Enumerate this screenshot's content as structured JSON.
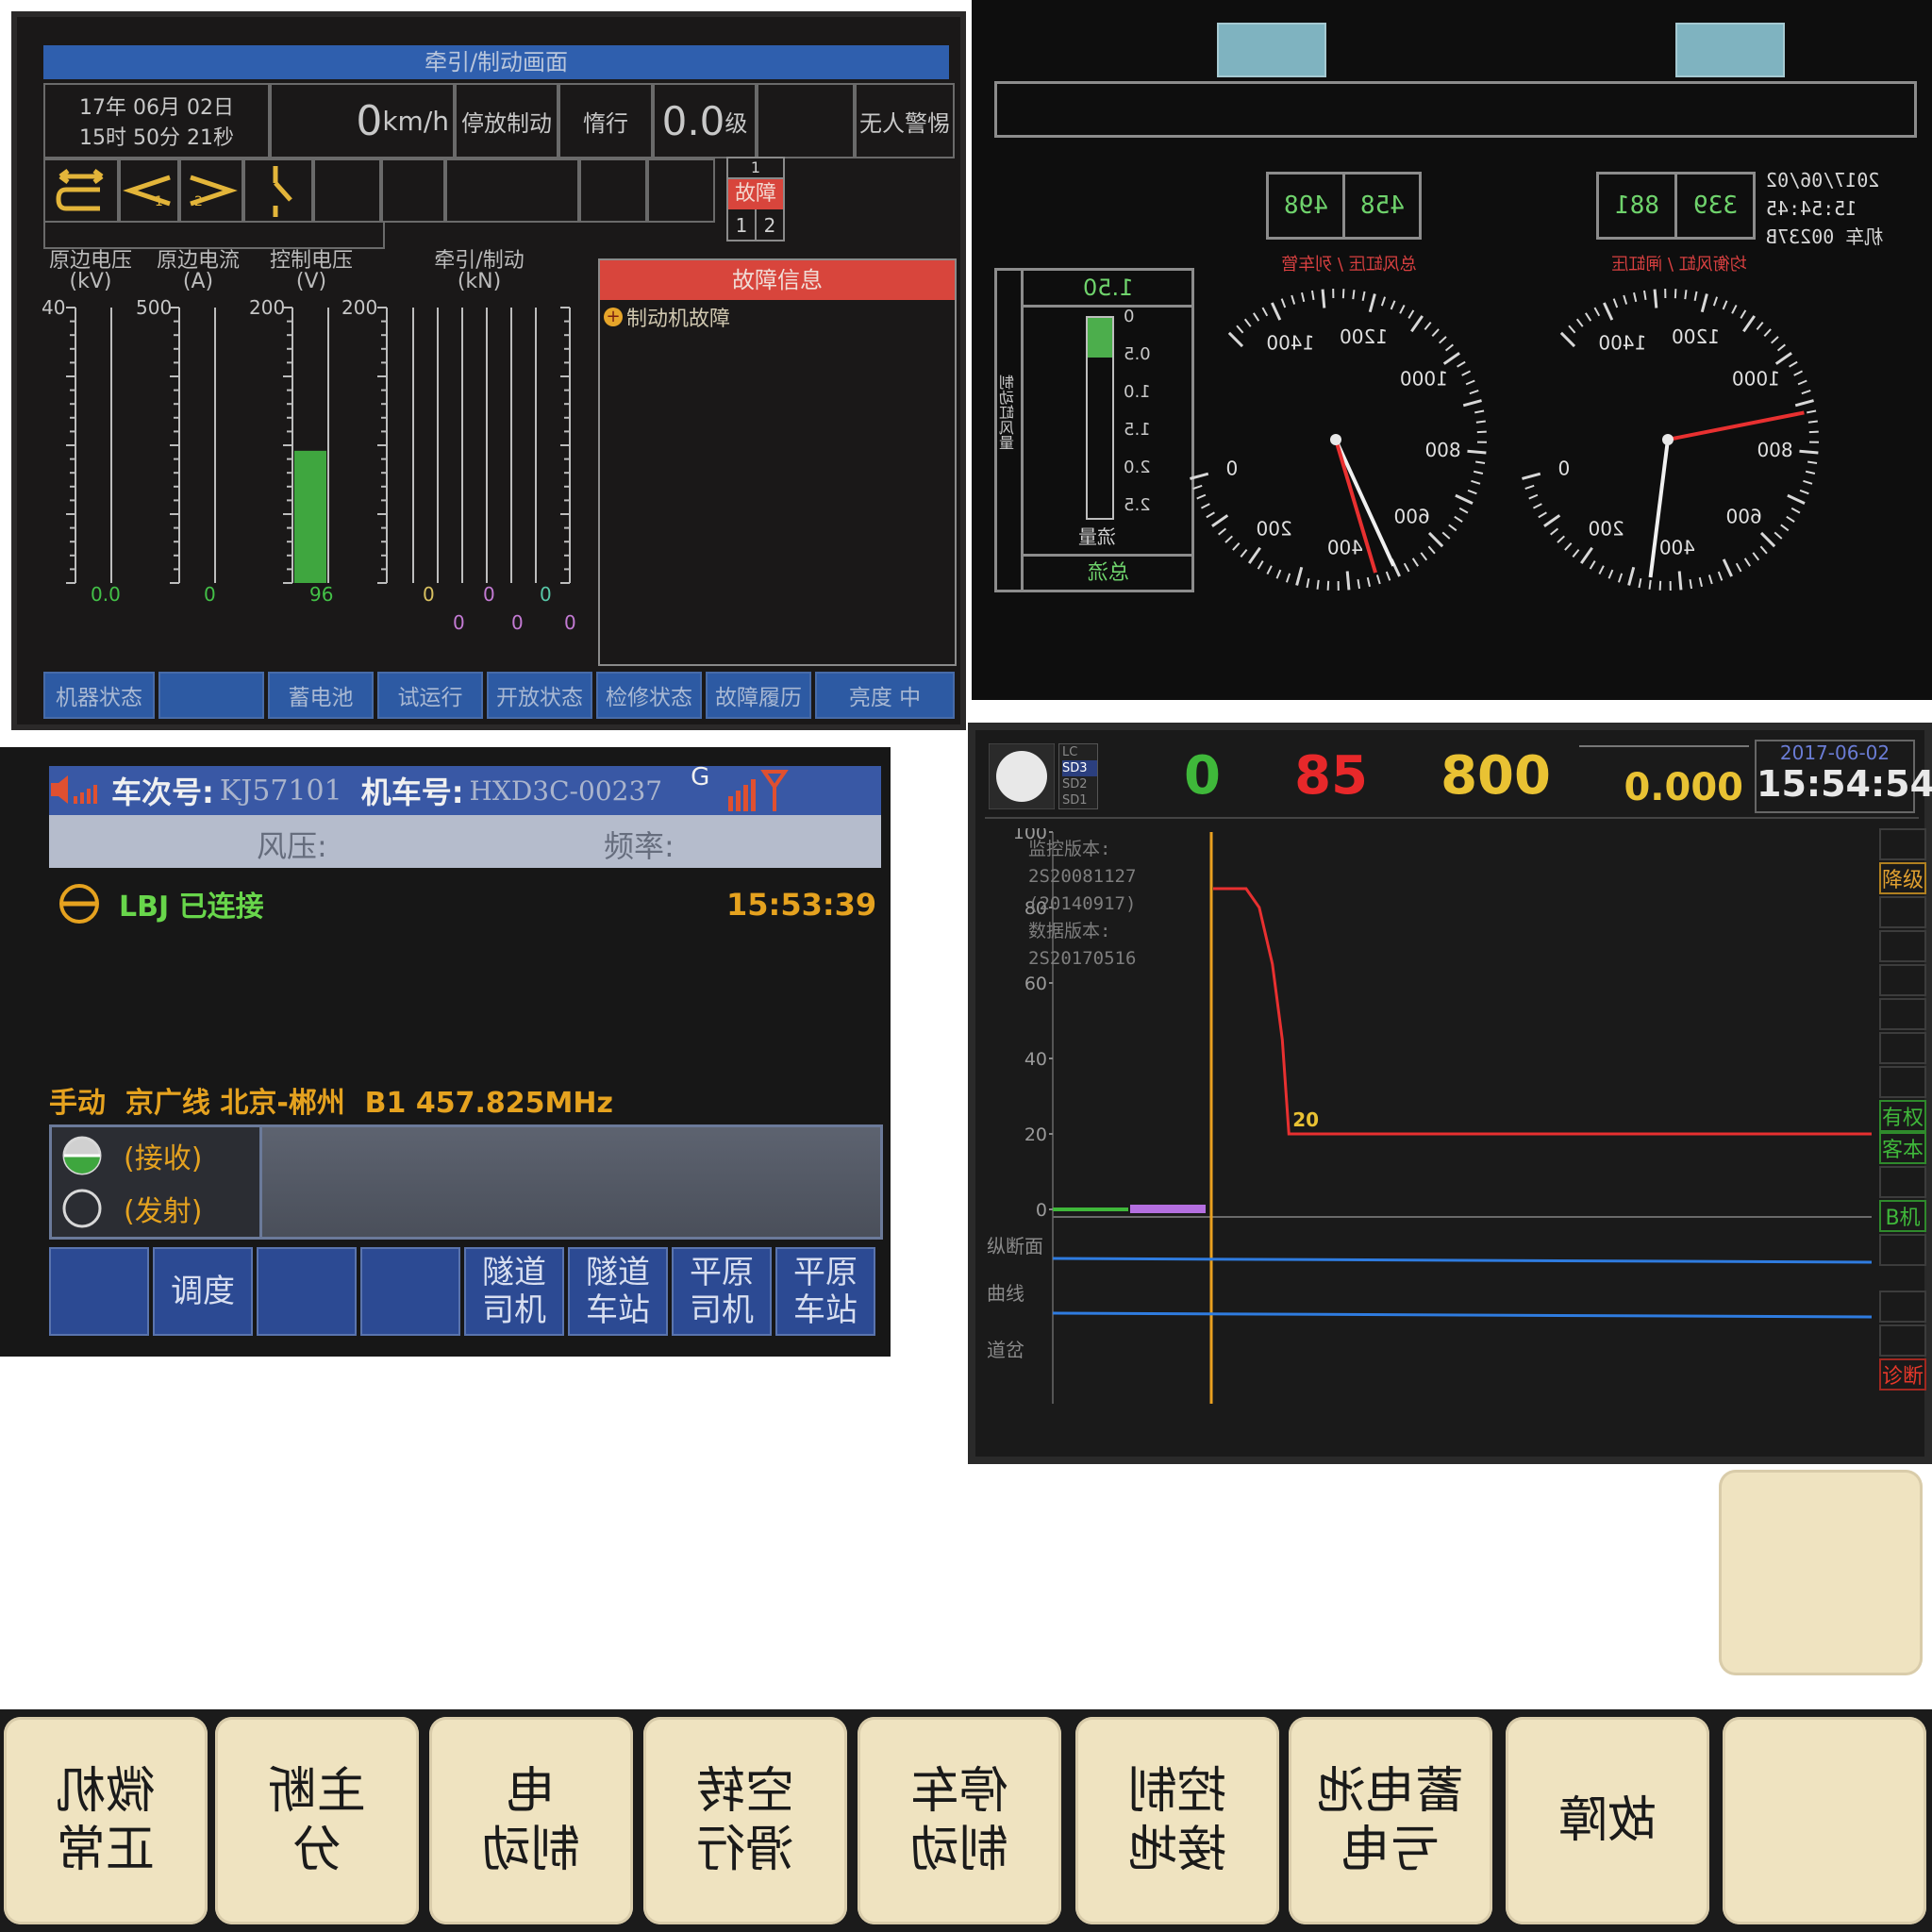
{
  "panel_traction": {
    "title": "牵引/制动画面",
    "date_line1": "17年  06月  02日",
    "date_line2": "15时  50分  21秒",
    "speed_value": "0",
    "speed_unit": "km/h",
    "status_parking": "停放制动",
    "status_coast": "惰行",
    "level_value": "0.0",
    "level_unit": "级",
    "vigilance": "无人警惕",
    "fault_indicator": "故障",
    "fault_idx_1": "1",
    "fault_idx_2": "1",
    "fault_idx_3": "2",
    "meter_labels": [
      "原边电压\n(kV)",
      "原边电流\n(A)",
      "控制电压\n(V)",
      "牵引/制动\n(kN)"
    ],
    "meter_max": [
      "40",
      "500",
      "200",
      "200"
    ],
    "meter_values": [
      "0.0",
      "0",
      "96"
    ],
    "control_voltage_fill_fraction": 0.48,
    "traction_values_top": [
      "0",
      "0",
      "0"
    ],
    "traction_values_bottom": [
      "0",
      "0",
      "0"
    ],
    "fault_info_title": "故障信息",
    "fault_item": "制动机故障",
    "soft_buttons": [
      "机器状态",
      "",
      "蓄电池",
      "试运行",
      "开放状态",
      "检修状态",
      "故障履历",
      "亮度   中"
    ]
  },
  "panel_gauges": {
    "left_box_values": [
      "498",
      "458"
    ],
    "right_box_values": [
      "881",
      "339"
    ],
    "datetime_lines": [
      "2017/06/02",
      "15:54:45",
      "机车  00237B"
    ],
    "left_caption": "总风缸压 / 列车管",
    "right_caption": "均衡风缸 / 闸缸压",
    "bar_top_value": "1.50",
    "bar_scale": [
      "0",
      "0.5",
      "1.0",
      "1.5",
      "2.0",
      "2.5"
    ],
    "bar_fill_fraction": 0.5,
    "bar_bottom_label": "流量",
    "bar_foot_label": "总流",
    "bar_side_label": "制动缸风量",
    "dial_labels": [
      "0",
      "200",
      "400",
      "600",
      "800",
      "1000",
      "1200",
      "1400"
    ],
    "left_dial_red_kpa": 458,
    "left_dial_white_kpa": 498,
    "right_dial_red_kpa": 881,
    "right_dial_white_kpa": 339
  },
  "panel_radio": {
    "train_no_label": "车次号:",
    "train_no": "KJ57101",
    "loco_no_label": "机车号:",
    "loco_no": "HXD3C-00237",
    "g_mark": "G",
    "wind_pressure": "风压:",
    "frequency": "频率:",
    "lbj_status": "LBJ 已连接",
    "time": "15:53:39",
    "mode_line": "手动  京广线 北京-郴州  B1 457.825MHz",
    "receive": "(接收)",
    "transmit": "(发射)",
    "buttons": [
      "",
      "调度",
      "",
      "",
      "隧道\n司机",
      "隧道\n车站",
      "平原\n司机",
      "平原\n车站"
    ]
  },
  "panel_monitor": {
    "sd_labels": [
      "LC",
      "SD3",
      "SD2",
      "SD1"
    ],
    "speed": "0",
    "limit_speed": "85",
    "distance": "800",
    "km_post": "0.000",
    "date": "2017-06-02",
    "time": "15:54:54",
    "y_ticks": [
      "100",
      "80",
      "60",
      "40",
      "20",
      "0"
    ],
    "version_lines": [
      "监控版本:",
      "2S20081127",
      "(20140917)",
      "数据版本:",
      "2S20170516"
    ],
    "curve_label": "20",
    "row_labels": [
      "纵断面",
      "曲线",
      "道岔"
    ],
    "side_labels": [
      "降级",
      "",
      "",
      "",
      "",
      "",
      "",
      "有权",
      "客本",
      "",
      "B机",
      "",
      "",
      "",
      "诊断"
    ]
  },
  "chart_data": {
    "type": "line",
    "title": "",
    "xlabel": "",
    "ylabel": "",
    "ylim": [
      0,
      100
    ],
    "series": [
      {
        "values": [
          85,
          85,
          80,
          65,
          45,
          20,
          20,
          20,
          20
        ]
      }
    ],
    "annotation": "20"
  },
  "keys": {
    "standalone": "",
    "labels": [
      "微机\n正常",
      "主断\n分",
      "电\n制动",
      "空转\n滑行",
      "停车\n制动",
      "控制\n接地",
      "蓄电池\n亏电",
      "故障",
      ""
    ]
  }
}
